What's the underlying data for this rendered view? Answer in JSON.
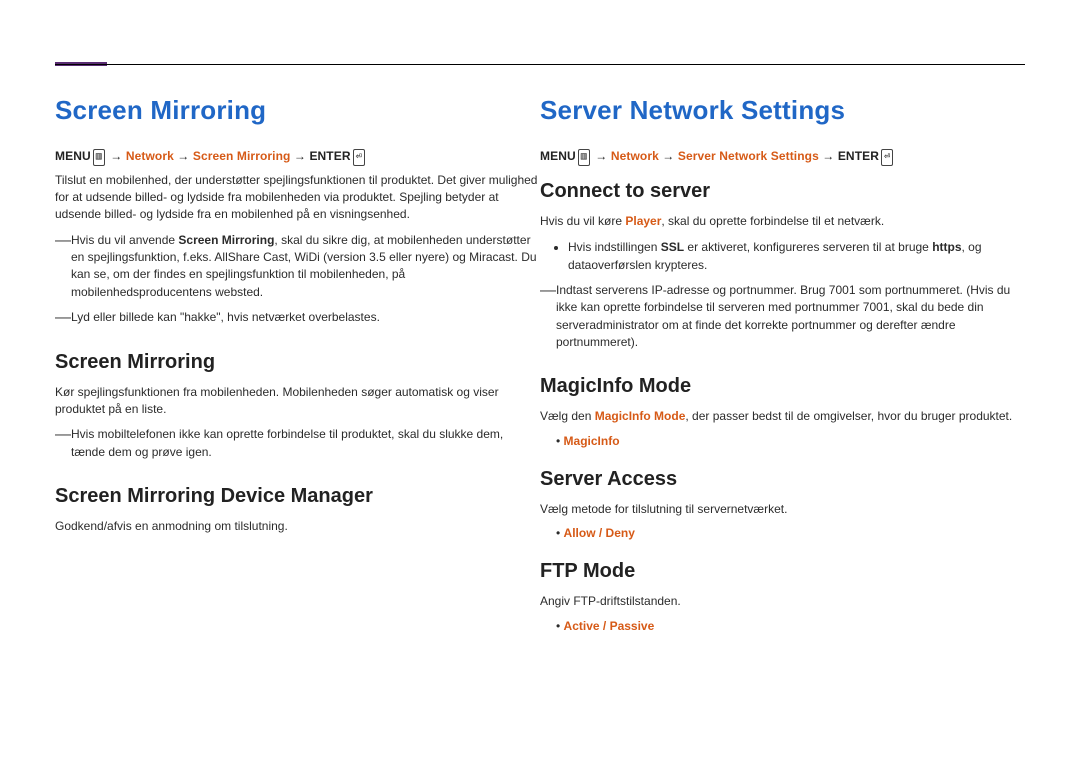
{
  "left": {
    "title": "Screen Mirroring",
    "crumb": {
      "menu": "MENU",
      "menu_icon": "▥",
      "arrow": " → ",
      "p1": "Network",
      "p2": "Screen Mirroring",
      "enter": "ENTER",
      "enter_icon": "⏎"
    },
    "intro": "Tilslut en mobilenhed, der understøtter spejlingsfunktionen til produktet. Det giver mulighed for at udsende billed- og lydside fra mobilenheden via produktet. Spejling betyder at udsende billed- og lydside fra en mobilenhed på en visningsenhed.",
    "note1_pre": "Hvis du vil anvende ",
    "note1_sm": "Screen Mirroring",
    "note1_post": ", skal du sikre dig, at mobilenheden understøtter en spejlingsfunktion, f.eks. AllShare Cast, WiDi (version 3.5 eller nyere) og Miracast. Du kan se, om der findes en spejlingsfunktion til mobilenheden, på mobilenhedsproducentens websted.",
    "note2": "Lyd eller billede kan \"hakke\", hvis netværket overbelastes.",
    "h2a": "Screen Mirroring",
    "p2": "Kør spejlingsfunktionen fra mobilenheden. Mobilenheden søger automatisk og viser produktet på en liste.",
    "note3": "Hvis mobiltelefonen ikke kan oprette forbindelse til produktet, skal du slukke dem, tænde dem og prøve igen.",
    "h2b": "Screen Mirroring Device Manager",
    "p3": "Godkend/afvis en anmodning om tilslutning."
  },
  "right": {
    "title": "Server Network Settings",
    "crumb": {
      "menu": "MENU",
      "menu_icon": "▥",
      "arrow": " → ",
      "p1": "Network",
      "p2": "Server Network Settings",
      "enter": "ENTER",
      "enter_icon": "⏎"
    },
    "h2a": "Connect to server",
    "p1_pre": "Hvis du vil køre ",
    "p1_player": "Player",
    "p1_post": ", skal du oprette forbindelse til et netværk.",
    "li1_pre": "Hvis indstillingen ",
    "li1_ssl": "SSL",
    "li1_mid": " er aktiveret, konfigureres serveren til at bruge ",
    "li1_https": "https",
    "li1_post": ", og dataoverførslen krypteres.",
    "note1": "Indtast serverens IP-adresse og portnummer. Brug 7001 som portnummeret. (Hvis du ikke kan oprette forbindelse til serveren med portnummer 7001, skal du bede din serveradministrator om at finde det korrekte portnummer og derefter ændre portnummeret).",
    "h2b": "MagicInfo Mode",
    "p2_pre": "Vælg den ",
    "p2_mi": "MagicInfo Mode",
    "p2_post": ", der passer bedst til de omgivelser, hvor du bruger produktet.",
    "opt1": "MagicInfo",
    "h2c": "Server Access",
    "p3": "Vælg metode for tilslutning til servernetværket.",
    "opt2": "Allow / Deny",
    "h2d": "FTP Mode",
    "p4": "Angiv FTP-driftstilstanden.",
    "opt3": "Active / Passive"
  }
}
